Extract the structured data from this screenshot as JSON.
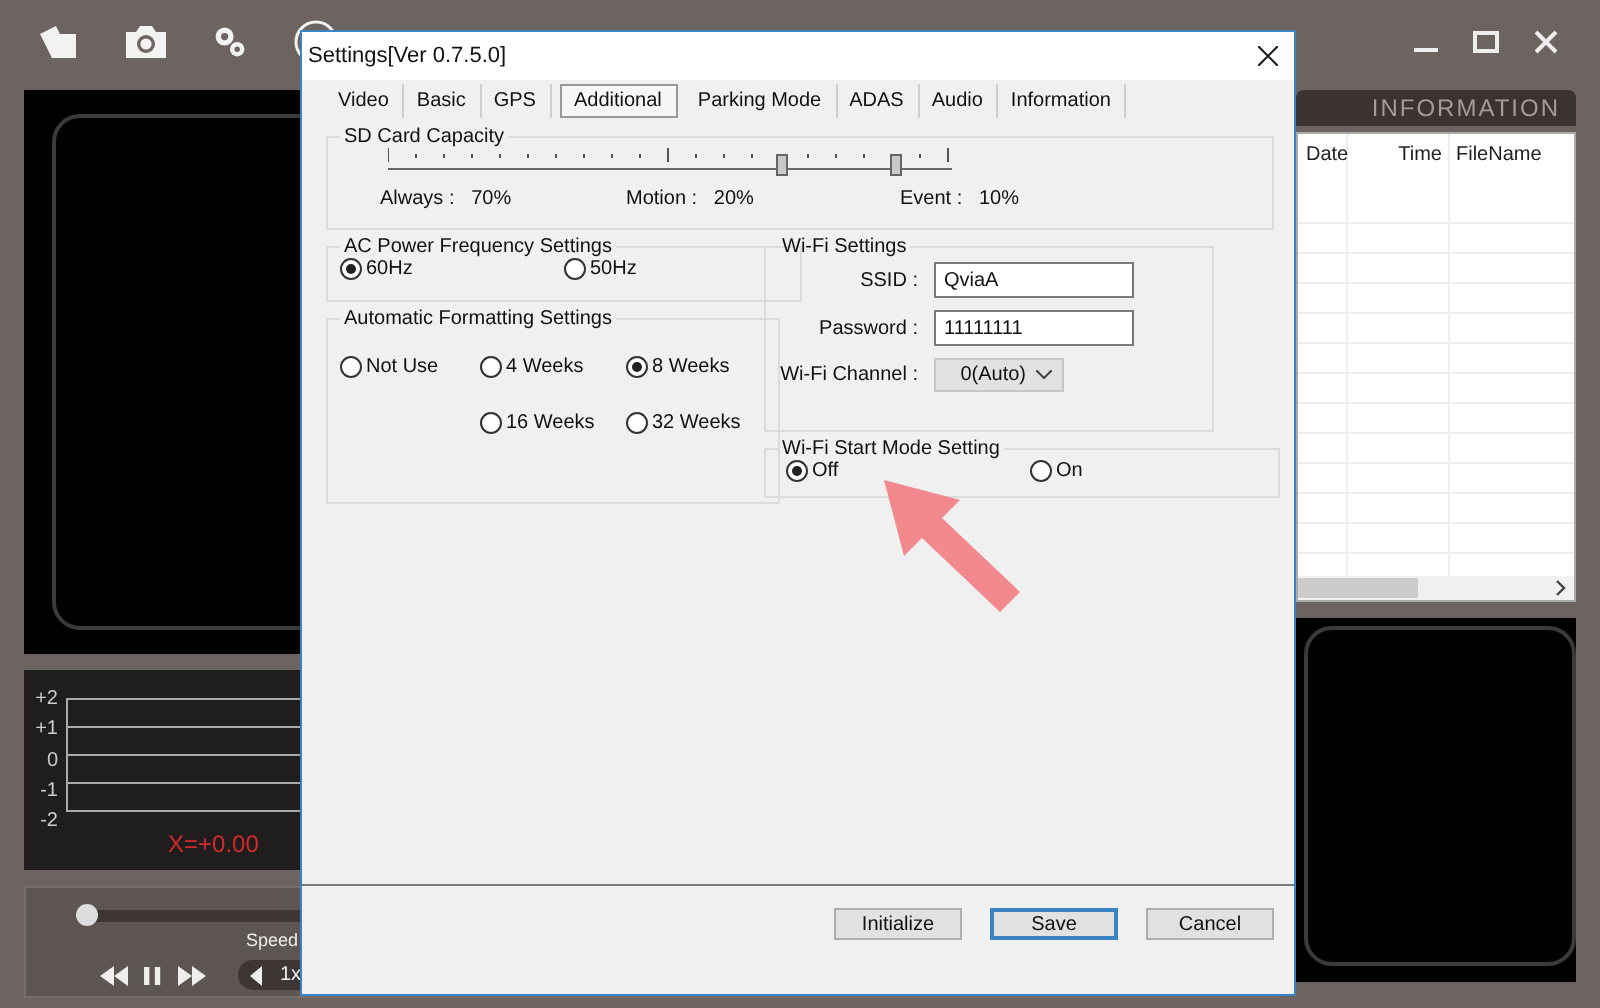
{
  "app": {
    "info_tab": "INFORMATION",
    "table": {
      "columns": [
        "Date",
        "Time",
        "FileName"
      ]
    },
    "graph": {
      "y_labels": [
        "+2",
        "+1",
        "0",
        "-1",
        "-2"
      ],
      "readout": "X=+0.00"
    },
    "playback": {
      "level": 0.0,
      "speed_label": "Speed",
      "speed": "1x"
    }
  },
  "dialog": {
    "title": "Settings[Ver 0.7.5.0]",
    "tabs": [
      {
        "label": "Video",
        "selected": false
      },
      {
        "label": "Basic",
        "selected": false
      },
      {
        "label": "GPS",
        "selected": false
      },
      {
        "label": "Additional",
        "selected": true
      },
      {
        "label": "Parking Mode",
        "selected": false
      },
      {
        "label": "ADAS",
        "selected": false
      },
      {
        "label": "Audio",
        "selected": false
      },
      {
        "label": "Information",
        "selected": false
      }
    ],
    "sd_card": {
      "title": "SD Card Capacity",
      "thumbs": [
        {
          "level": 0.7
        },
        {
          "level": 0.9
        }
      ],
      "readings": [
        {
          "label": "Always :",
          "value": "70%"
        },
        {
          "label": "Motion :",
          "value": "20%"
        },
        {
          "label": "Event :",
          "value": "10%"
        }
      ]
    },
    "ac_power": {
      "title": "AC Power Frequency Settings",
      "options": [
        {
          "label": "60Hz",
          "selected": true
        },
        {
          "label": "50Hz",
          "selected": false
        }
      ]
    },
    "auto_format": {
      "title": "Automatic Formatting Settings",
      "options": [
        {
          "label": "Not Use",
          "selected": false
        },
        {
          "label": "4 Weeks",
          "selected": false
        },
        {
          "label": "8 Weeks",
          "selected": true
        },
        {
          "label": "16 Weeks",
          "selected": false
        },
        {
          "label": "32 Weeks",
          "selected": false
        }
      ]
    },
    "wifi": {
      "title": "Wi-Fi Settings",
      "ssid": {
        "label": "SSID :",
        "value": "QviaA"
      },
      "password": {
        "label": "Password :",
        "value": "11111111"
      },
      "channel": {
        "label": "Wi-Fi Channel :",
        "value": "0(Auto)"
      }
    },
    "wifi_start": {
      "title": "Wi-Fi Start Mode Setting",
      "options": [
        {
          "label": "Off",
          "selected": true
        },
        {
          "label": "On",
          "selected": false
        }
      ]
    },
    "buttons": [
      {
        "label": "Initialize",
        "kind": "normal"
      },
      {
        "label": "Save",
        "kind": "default"
      },
      {
        "label": "Cancel",
        "kind": "normal"
      }
    ]
  }
}
